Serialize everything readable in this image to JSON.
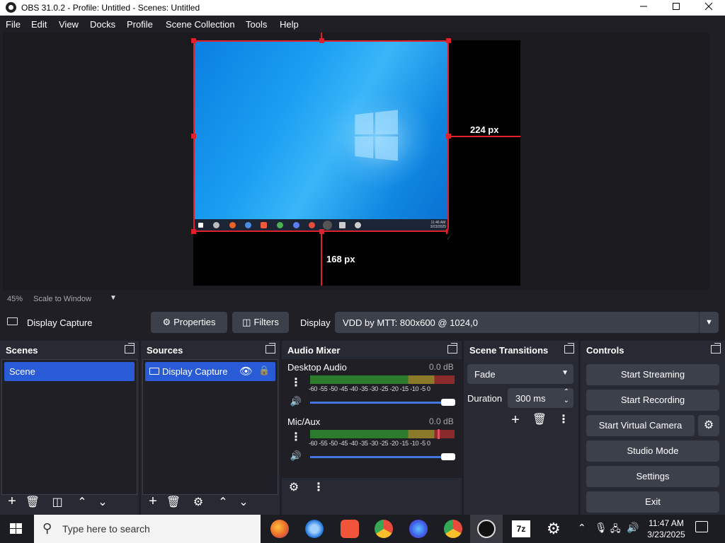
{
  "window": {
    "title": "OBS 31.0.2 - Profile: Untitled - Scenes: Untitled",
    "minimize_icon": "minimize-icon",
    "maximize_icon": "maximize-icon",
    "close_icon": "close-icon"
  },
  "menu": [
    "File",
    "Edit",
    "View",
    "Docks",
    "Profile",
    "Scene Collection",
    "Tools",
    "Help"
  ],
  "preview": {
    "right_distance": "224 px",
    "bottom_distance": "168 px",
    "mini_clock_time": "11:46 AM",
    "mini_clock_date": "3/23/2025"
  },
  "scale": {
    "percent": "45%",
    "mode": "Scale to Window"
  },
  "source_toolbar": {
    "selected_source": "Display Capture",
    "properties": "Properties",
    "filters": "Filters",
    "display_label": "Display",
    "display_value": "VDD by MTT: 800x600 @ 1024,0"
  },
  "scenes": {
    "title": "Scenes",
    "items": [
      "Scene"
    ]
  },
  "sources": {
    "title": "Sources",
    "items": [
      "Display Capture"
    ]
  },
  "audio_mixer": {
    "title": "Audio Mixer",
    "channels": [
      {
        "name": "Desktop Audio",
        "db": "0.0 dB",
        "volume": 1.0
      },
      {
        "name": "Mic/Aux",
        "db": "0.0 dB",
        "volume": 1.0
      }
    ],
    "ticks": "-60 -55 -50 -45 -40 -35 -30 -25 -20 -15 -10 -5  0"
  },
  "scene_transitions": {
    "title": "Scene Transitions",
    "transition": "Fade",
    "duration_label": "Duration",
    "duration_value": "300 ms"
  },
  "controls": {
    "title": "Controls",
    "buttons": [
      "Start Streaming",
      "Start Recording",
      "Start Virtual Camera",
      "Studio Mode",
      "Settings",
      "Exit"
    ]
  },
  "taskbar": {
    "search_placeholder": "Type here to search",
    "time": "11:47 AM",
    "date": "3/23/2025"
  }
}
